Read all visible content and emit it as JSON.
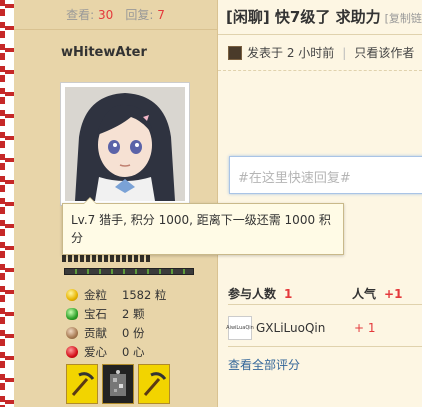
{
  "stats": {
    "views_label": "查看:",
    "views": "30",
    "replies_label": "回复:",
    "replies": "7"
  },
  "user": {
    "name": "wHitewAter",
    "level_tooltip": "Lv.7 猎手, 积分 1000, 距离下一级还需 1000 积分",
    "stats": [
      {
        "icon": "gold-coin-icon",
        "label": "金粒",
        "value": "1582 粒"
      },
      {
        "icon": "gem-icon",
        "label": "宝石",
        "value": "2 颗"
      },
      {
        "icon": "contribution-icon",
        "label": "贡献",
        "value": "0 份"
      },
      {
        "icon": "heart-icon",
        "label": "爱心",
        "value": "0 心"
      }
    ]
  },
  "thread": {
    "title": "[闲聊] 快7级了 求助力",
    "copy_link": "[复制链",
    "posted_at": "发表于 2 小时前",
    "only_author": "只看该作者"
  },
  "reply": {
    "placeholder": "#在这里快速回复#"
  },
  "rating": {
    "participants_label": "参与人数",
    "participants": "1",
    "popularity_label": "人气",
    "popularity": "+1",
    "rows": [
      {
        "avatar_text": "AiwiLuaQin",
        "name": "GXLiLuoQin",
        "value": "+ 1"
      }
    ],
    "view_all": "查看全部评分"
  },
  "colors": {
    "accent_red": "#e4393c",
    "sidebar_bg": "#e8d5a9",
    "link_blue": "#336699"
  }
}
